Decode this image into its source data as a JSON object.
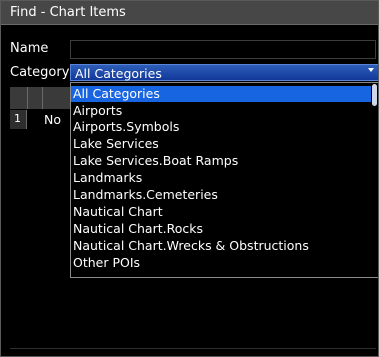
{
  "window": {
    "title": "Find - Chart Items"
  },
  "form": {
    "name_label": "Name",
    "name_value": "",
    "category_label": "Category",
    "category_value": "All Categories"
  },
  "results": {
    "rows": [
      {
        "number": "1",
        "text": "No"
      }
    ]
  },
  "dropdown": {
    "options": [
      {
        "label": "All Categories",
        "selected": true
      },
      {
        "label": "Airports",
        "selected": false
      },
      {
        "label": "Airports.Symbols",
        "selected": false
      },
      {
        "label": "Lake Services",
        "selected": false
      },
      {
        "label": "Lake Services.Boat Ramps",
        "selected": false
      },
      {
        "label": "Landmarks",
        "selected": false
      },
      {
        "label": "Landmarks.Cemeteries",
        "selected": false
      },
      {
        "label": "Nautical Chart",
        "selected": false
      },
      {
        "label": "Nautical Chart.Rocks",
        "selected": false
      },
      {
        "label": "Nautical Chart.Wrecks & Obstructions",
        "selected": false
      },
      {
        "label": "Other POIs",
        "selected": false
      }
    ]
  },
  "colors": {
    "selection": "#1865e2",
    "title_bar": "#474747",
    "background": "#000000"
  }
}
